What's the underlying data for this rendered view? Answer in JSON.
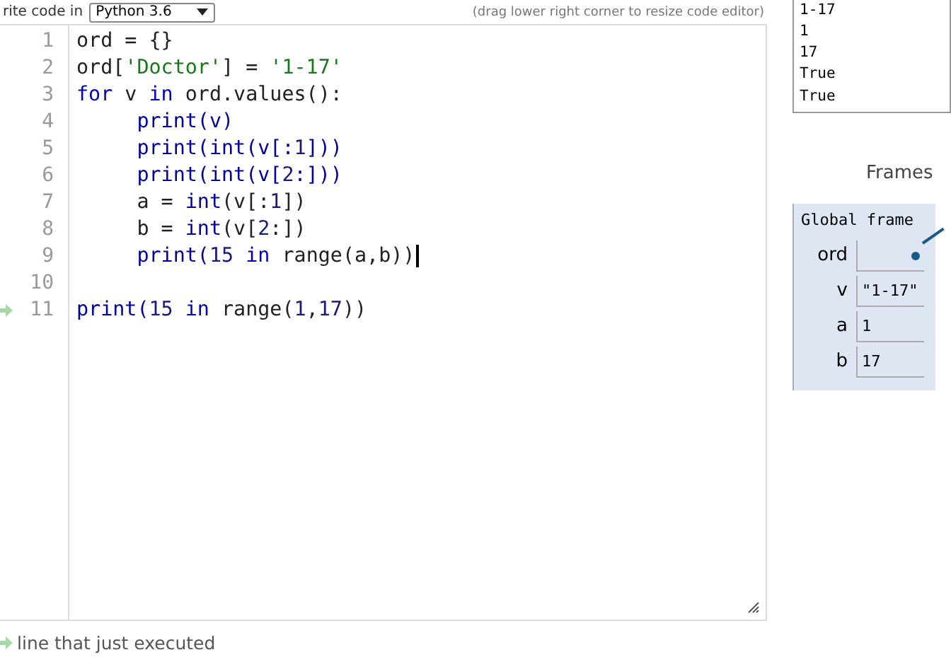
{
  "header": {
    "label": "rite code in",
    "language": "Python 3.6",
    "hint": "(drag lower right corner to resize code editor)"
  },
  "code_lines": [
    {
      "number": "1",
      "tokens": [
        {
          "text": "ord = {}",
          "kind": "plain"
        }
      ]
    },
    {
      "number": "2",
      "tokens": [
        {
          "text": "ord[",
          "kind": "plain"
        },
        {
          "text": "'Doctor'",
          "kind": "string"
        },
        {
          "text": "] = ",
          "kind": "plain"
        },
        {
          "text": "'1-17'",
          "kind": "string"
        }
      ]
    },
    {
      "number": "3",
      "tokens": [
        {
          "text": "for",
          "kind": "keyword"
        },
        {
          "text": " v ",
          "kind": "plain"
        },
        {
          "text": "in",
          "kind": "keyword"
        },
        {
          "text": " ord.values():",
          "kind": "plain"
        }
      ]
    },
    {
      "number": "4",
      "tokens": [
        {
          "text": "     print",
          "kind": "builtin"
        },
        {
          "text": "(v)",
          "kind": "builtin"
        }
      ]
    },
    {
      "number": "5",
      "tokens": [
        {
          "text": "     print(int(v[:",
          "kind": "builtin"
        },
        {
          "text": "1",
          "kind": "number"
        },
        {
          "text": "]))",
          "kind": "builtin"
        }
      ]
    },
    {
      "number": "6",
      "tokens": [
        {
          "text": "     print(int(v[",
          "kind": "builtin"
        },
        {
          "text": "2",
          "kind": "number"
        },
        {
          "text": ":]))",
          "kind": "builtin"
        }
      ]
    },
    {
      "number": "7",
      "tokens": [
        {
          "text": "     a = ",
          "kind": "plain"
        },
        {
          "text": "int",
          "kind": "builtin"
        },
        {
          "text": "(v[:",
          "kind": "plain"
        },
        {
          "text": "1",
          "kind": "number"
        },
        {
          "text": "])",
          "kind": "plain"
        }
      ]
    },
    {
      "number": "8",
      "tokens": [
        {
          "text": "     b = ",
          "kind": "plain"
        },
        {
          "text": "int",
          "kind": "builtin"
        },
        {
          "text": "(v[",
          "kind": "plain"
        },
        {
          "text": "2",
          "kind": "number"
        },
        {
          "text": ":])",
          "kind": "plain"
        }
      ]
    },
    {
      "number": "9",
      "cursor": true,
      "tokens": [
        {
          "text": "     print(",
          "kind": "builtin"
        },
        {
          "text": "15",
          "kind": "number"
        },
        {
          "text": " in ",
          "kind": "keyword"
        },
        {
          "text": "range(a,b))",
          "kind": "plain"
        }
      ]
    },
    {
      "number": "10"
    },
    {
      "number": "11",
      "current": true,
      "tokens": [
        {
          "text": "print(",
          "kind": "builtin"
        },
        {
          "text": "15",
          "kind": "number"
        },
        {
          "text": " in ",
          "kind": "keyword"
        },
        {
          "text": "range(",
          "kind": "plain"
        },
        {
          "text": "1",
          "kind": "number"
        },
        {
          "text": ",",
          "kind": "plain"
        },
        {
          "text": "17",
          "kind": "number"
        },
        {
          "text": "))",
          "kind": "plain"
        }
      ]
    }
  ],
  "output_lines": [
    "1-17",
    "1",
    "17",
    "True",
    "True"
  ],
  "frames": {
    "title": "Frames",
    "frame_name": "Global frame",
    "variables": [
      {
        "name": "ord",
        "kind": "pointer"
      },
      {
        "name": "v",
        "value": "\"1-17\"",
        "kind": "value"
      },
      {
        "name": "a",
        "value": "1",
        "kind": "value"
      },
      {
        "name": "b",
        "value": "17",
        "kind": "value"
      }
    ]
  },
  "legend": {
    "label": "line that just executed"
  }
}
